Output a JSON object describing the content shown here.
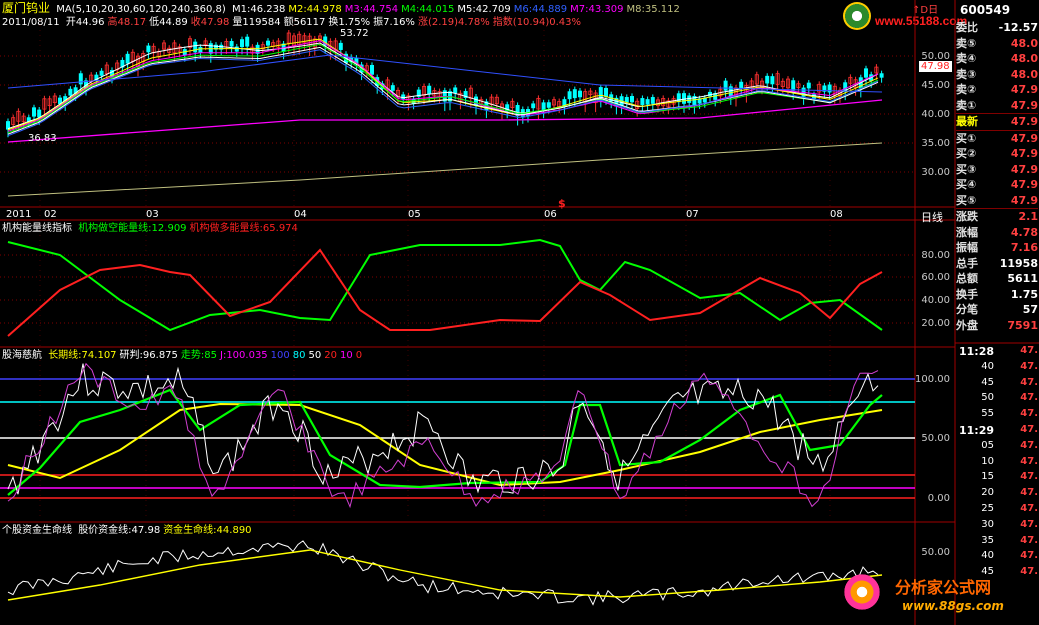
{
  "header": {
    "stock_name": "厦门钨业",
    "ma_label": "MA(5,10,20,30,60,120,240,360,8)",
    "ma_values": [
      {
        "text": "M1:46.238",
        "color": "#ffffff"
      },
      {
        "text": "M2:44.978",
        "color": "#ffff00"
      },
      {
        "text": "M3:44.754",
        "color": "#ff00ff"
      },
      {
        "text": "M4:44.015",
        "color": "#00ff00"
      },
      {
        "text": "M5:42.709",
        "color": "#ffffff"
      },
      {
        "text": "M6:44.889",
        "color": "#3060ff"
      },
      {
        "text": "M7:43.309",
        "color": "#ff00ff"
      },
      {
        "text": "M8:35.112",
        "color": "#c0c080"
      }
    ],
    "date": "2011/08/11",
    "ohlc": [
      {
        "text": "开44.96",
        "color": "#ffffff"
      },
      {
        "text": "高48.17",
        "color": "#ff4040"
      },
      {
        "text": "低44.89",
        "color": "#ffffff"
      },
      {
        "text": "收47.98",
        "color": "#ff4040"
      },
      {
        "text": "量119584",
        "color": "#ffffff"
      },
      {
        "text": "额56117",
        "color": "#ffffff"
      },
      {
        "text": "换1.75%",
        "color": "#ffffff"
      },
      {
        "text": "振7.16%",
        "color": "#ffffff"
      },
      {
        "text": "涨(2.19)4.78%",
        "color": "#ff4040"
      },
      {
        "text": "指数(10.94)0.43%",
        "color": "#ff4040"
      }
    ]
  },
  "logo_top": {
    "code": "600549",
    "site": "www.55188.com",
    "extra": "↑D日"
  },
  "main_chart": {
    "price_ticks": [
      "50.00",
      "45.00",
      "40.00",
      "35.00",
      "30.00"
    ],
    "current_price": "47.98",
    "high_label": "53.72",
    "low_label": "36.83",
    "x_labels": [
      "2011",
      "02",
      "03",
      "04",
      "05",
      "06",
      "07",
      "08"
    ],
    "period": "日线",
    "marker": "$"
  },
  "indicator1": {
    "title": "机构能量线指标",
    "lines": [
      {
        "text": "机构做空能量线:12.909",
        "color": "#00ff00"
      },
      {
        "text": "机构做多能量线:65.974",
        "color": "#ff2020"
      }
    ],
    "ticks": [
      "80.00",
      "60.00",
      "40.00",
      "20.00"
    ]
  },
  "indicator2": {
    "title": "股海慈航",
    "lines": [
      {
        "text": "长期线:74.107",
        "color": "#ffff00"
      },
      {
        "text": "研判:96.875",
        "color": "#ffffff"
      },
      {
        "text": "走势:85",
        "color": "#00ff00"
      },
      {
        "text": "J:100.035",
        "color": "#ff00ff"
      },
      {
        "text": "100",
        "color": "#4040ff"
      },
      {
        "text": "80",
        "color": "#00ffff"
      },
      {
        "text": "50",
        "color": "#ffffff"
      },
      {
        "text": "20",
        "color": "#ff2020"
      },
      {
        "text": "10",
        "color": "#ff00ff"
      },
      {
        "text": "0",
        "color": "#ff2020"
      }
    ],
    "ticks": [
      "100.00",
      "50.00",
      "0.00"
    ]
  },
  "indicator3": {
    "title": "个股资金生命线",
    "lines": [
      {
        "text": "股价资金线:47.98",
        "color": "#ffffff"
      },
      {
        "text": "资金生命线:44.890",
        "color": "#ffff00"
      }
    ],
    "ticks": [
      "50.00"
    ]
  },
  "quote_panel": {
    "top_label": "委比",
    "top_value": "-12.57",
    "sells": [
      {
        "label": "卖⑤",
        "value": "48.0"
      },
      {
        "label": "卖④",
        "value": "48.0"
      },
      {
        "label": "卖③",
        "value": "48.0"
      },
      {
        "label": "卖②",
        "value": "47.9"
      },
      {
        "label": "卖①",
        "value": "47.9"
      }
    ],
    "last": {
      "label": "最新",
      "value": "47.9"
    },
    "buys": [
      {
        "label": "买①",
        "value": "47.9"
      },
      {
        "label": "买②",
        "value": "47.9"
      },
      {
        "label": "买③",
        "value": "47.9"
      },
      {
        "label": "买④",
        "value": "47.9"
      },
      {
        "label": "买⑤",
        "value": "47.9"
      }
    ],
    "stats": [
      {
        "label": "涨跌",
        "value": "2.1"
      },
      {
        "label": "涨幅",
        "value": "4.78"
      },
      {
        "label": "振幅",
        "value": "7.16"
      },
      {
        "label": "总手",
        "value": "11958"
      },
      {
        "label": "总额",
        "value": "5611"
      },
      {
        "label": "换手",
        "value": "1.75"
      },
      {
        "label": "分笔",
        "value": "57"
      },
      {
        "label": "外盘",
        "value": "7591"
      }
    ],
    "ticks": [
      {
        "time": "11:28",
        "price": "47."
      },
      {
        "time": "40",
        "price": "47."
      },
      {
        "time": "45",
        "price": "47."
      },
      {
        "time": "50",
        "price": "47."
      },
      {
        "time": "55",
        "price": "47."
      },
      {
        "time": "11:29",
        "price": "47."
      },
      {
        "time": "05",
        "price": "47."
      },
      {
        "time": "10",
        "price": "47."
      },
      {
        "time": "15",
        "price": "47."
      },
      {
        "time": "20",
        "price": "47."
      },
      {
        "time": "25",
        "price": "47."
      },
      {
        "time": "30",
        "price": "47."
      },
      {
        "time": "35",
        "price": "47."
      },
      {
        "time": "40",
        "price": "47."
      },
      {
        "time": "45",
        "price": "47."
      }
    ]
  },
  "watermark": {
    "name": "分析家公式网",
    "url": "www.88gs.com"
  }
}
